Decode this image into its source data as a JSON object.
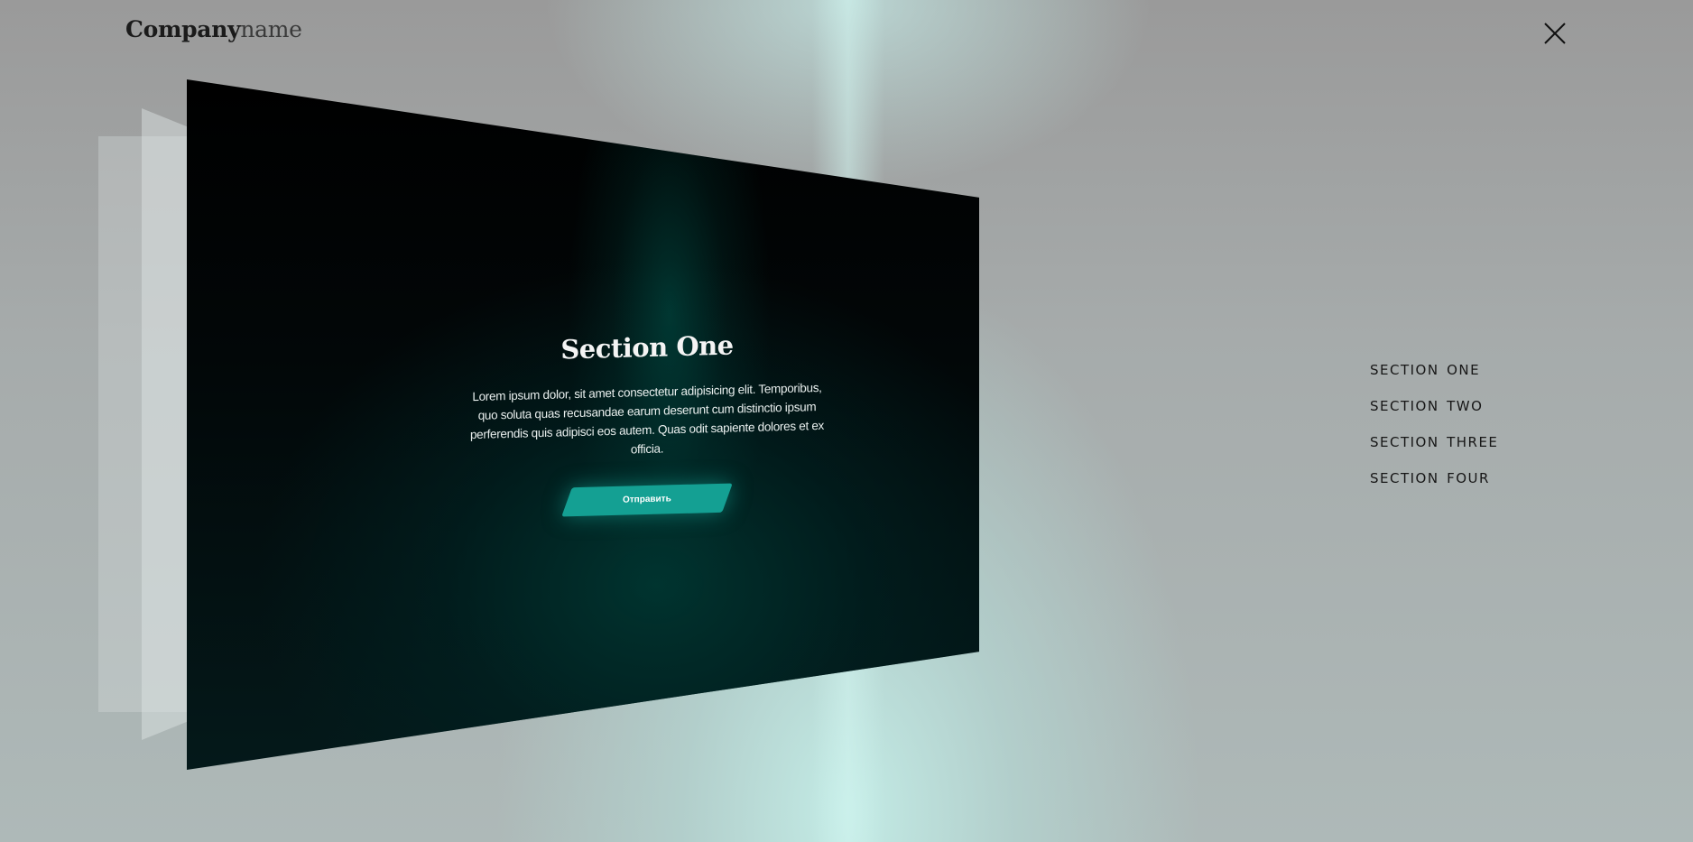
{
  "header": {
    "brand_bold": "Company",
    "brand_light": "name",
    "close_icon": "close-icon"
  },
  "card": {
    "title": "Section One",
    "body": "Lorem ipsum dolor, sit amet consectetur adipisicing elit. Temporibus, quo soluta quas recusandae earum deserunt cum distinctio ipsum perferendis quis adipisci eos autem. Quas odit sapiente dolores et ex officia.",
    "button_label": "Отправить",
    "accent_color": "#14a093"
  },
  "nav": {
    "items": [
      {
        "label": "section one"
      },
      {
        "label": "section two"
      },
      {
        "label": "section three"
      },
      {
        "label": "section four"
      }
    ]
  }
}
